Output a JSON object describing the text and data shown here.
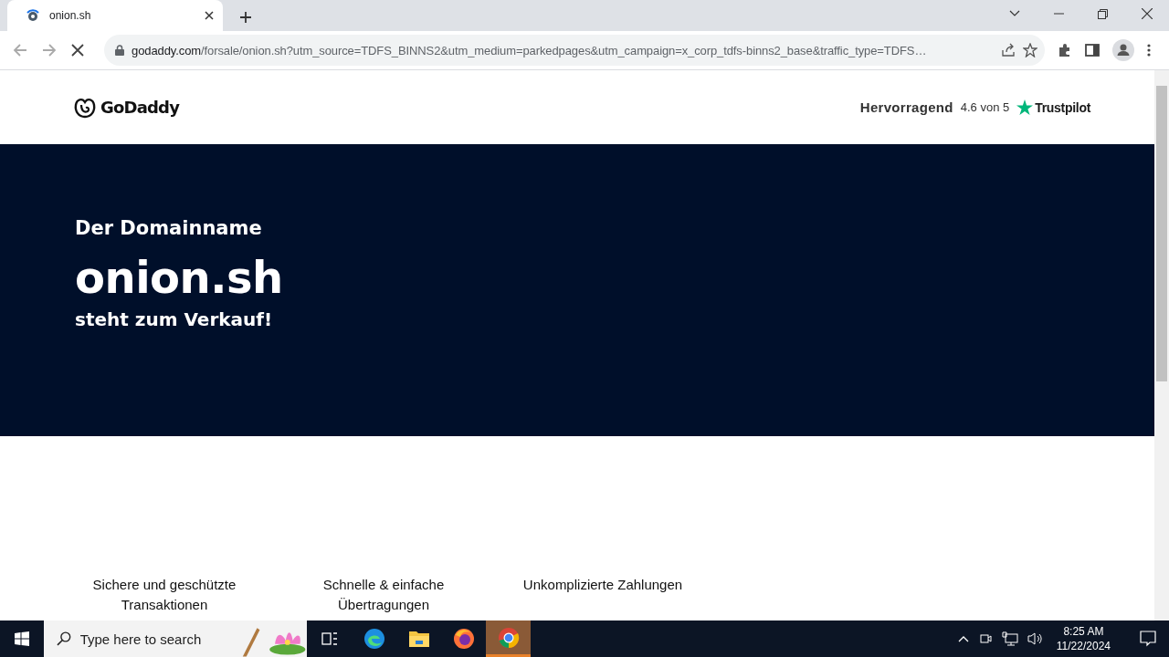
{
  "browser": {
    "tabs": [
      {
        "title": "onion.sh",
        "selected": true
      }
    ],
    "url_host": "godaddy.com",
    "url_path": "/forsale/onion.sh?utm_source=TDFS_BINNS2&utm_medium=parkedpages&utm_campaign=x_corp_tdfs-binns2_base&traffic_type=TDFS…"
  },
  "page": {
    "logo": "GoDaddy",
    "rating": {
      "label": "Hervorragend",
      "score": "4.6 von 5",
      "brand": "Trustpilot"
    },
    "hero": {
      "eyebrow": "Der Domainname",
      "domain": "onion.sh",
      "tagline": "steht zum Verkauf!"
    },
    "features": [
      "Sichere und geschützte Transaktionen",
      "Schnelle & einfache Übertragungen",
      "Unkomplizierte Zahlungen"
    ]
  },
  "taskbar": {
    "search_placeholder": "Type here to search",
    "apps": [
      {
        "kind": "taskview",
        "selected": false
      },
      {
        "kind": "edge",
        "selected": false
      },
      {
        "kind": "files",
        "selected": false
      },
      {
        "kind": "firefox",
        "selected": false
      },
      {
        "kind": "chrome",
        "selected": true
      }
    ],
    "time": "8:25 AM",
    "date": "11/22/2024"
  }
}
